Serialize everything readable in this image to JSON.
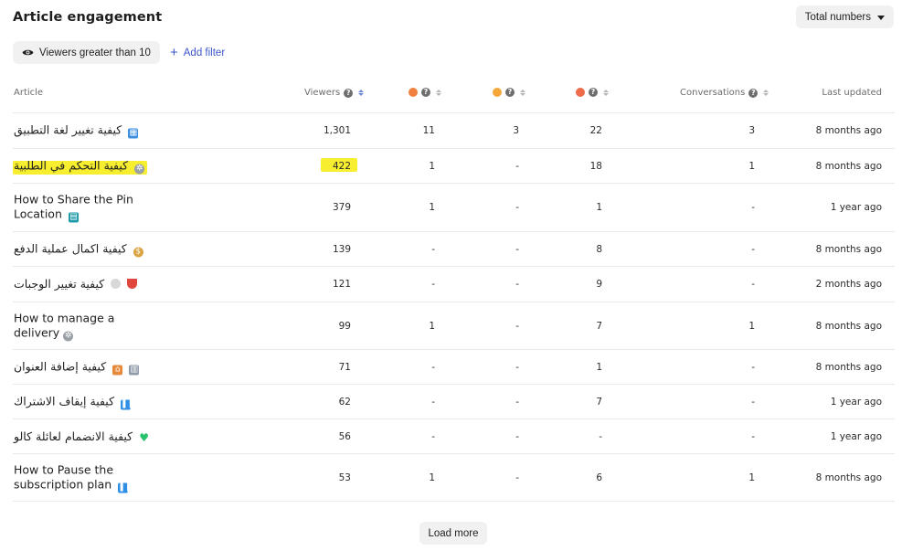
{
  "header": {
    "title": "Article engagement",
    "total_button": "Total numbers"
  },
  "filters": {
    "chip_label": "Viewers greater than 10",
    "add_filter_label": "Add filter"
  },
  "columns": {
    "article": "Article",
    "viewers": "Viewers",
    "conversations": "Conversations",
    "last_updated": "Last updated"
  },
  "rows": [
    {
      "article": "كيفية تغيير لغة التطبيق",
      "icon": "qr-code-icon",
      "viewers": "1,301",
      "sad": "11",
      "neutral": "3",
      "happy": "22",
      "conversations": "3",
      "updated": "8 months ago"
    },
    {
      "article": "كيفية التحكم في الطلبية",
      "icon": "gear-icon",
      "viewers": "422",
      "sad": "1",
      "neutral": "-",
      "happy": "18",
      "conversations": "1",
      "updated": "8 months ago"
    },
    {
      "article": "How to Share the Pin Location",
      "icon": "book-icon",
      "viewers": "379",
      "sad": "1",
      "neutral": "-",
      "happy": "1",
      "conversations": "-",
      "updated": "1 year ago"
    },
    {
      "article": "كيفية اكمال عملية الدفع",
      "icon": "money-bag-icon",
      "viewers": "139",
      "sad": "-",
      "neutral": "-",
      "happy": "8",
      "conversations": "-",
      "updated": "8 months ago"
    },
    {
      "article": "كيفية تغيير الوجبات",
      "icon": "plate-watermelon-icon",
      "viewers": "121",
      "sad": "-",
      "neutral": "-",
      "happy": "9",
      "conversations": "-",
      "updated": "2 months ago"
    },
    {
      "article": "How to manage a delivery",
      "icon": "gear-icon",
      "viewers": "99",
      "sad": "1",
      "neutral": "-",
      "happy": "7",
      "conversations": "1",
      "updated": "8 months ago"
    },
    {
      "article": "كيفية إضافة العنوان",
      "icon": "house-building-icon",
      "viewers": "71",
      "sad": "-",
      "neutral": "-",
      "happy": "1",
      "conversations": "-",
      "updated": "8 months ago"
    },
    {
      "article": "كيفية إيقاف الاشتراك",
      "icon": "pause-icon",
      "viewers": "62",
      "sad": "-",
      "neutral": "-",
      "happy": "7",
      "conversations": "-",
      "updated": "1 year ago"
    },
    {
      "article": "كيفية الانضمام لعائلة كالو",
      "icon": "green-heart-icon",
      "viewers": "56",
      "sad": "-",
      "neutral": "-",
      "happy": "-",
      "conversations": "-",
      "updated": "1 year ago"
    },
    {
      "article": "How to Pause the subscription plan",
      "icon": "pause-icon",
      "viewers": "53",
      "sad": "1",
      "neutral": "-",
      "happy": "6",
      "conversations": "1",
      "updated": "8 months ago"
    }
  ],
  "footer": {
    "load_more": "Load more"
  },
  "colors": {
    "accent": "#3d55c9",
    "highlight": "#f6ee2e",
    "row_border": "#e9e9e9"
  }
}
